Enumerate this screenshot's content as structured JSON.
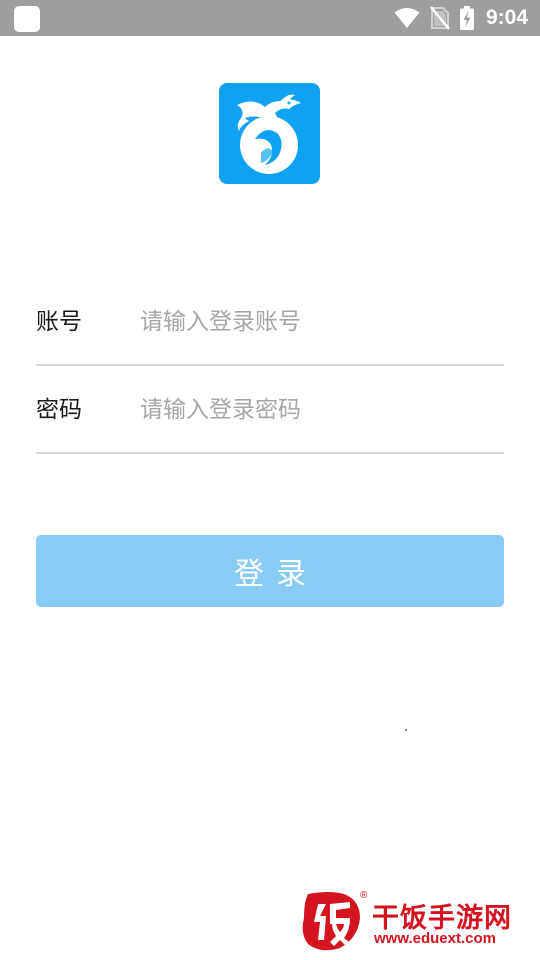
{
  "status_bar": {
    "time": "9:04",
    "icons": [
      "app-notification-icon",
      "wifi-icon",
      "no-sim-icon",
      "battery-charging-icon"
    ]
  },
  "app": {
    "logo_icon": "dragon-pearl-logo-icon",
    "accent_color": "#10a2f2"
  },
  "form": {
    "account": {
      "label": "账号",
      "placeholder": "请输入登录账号",
      "value": ""
    },
    "password": {
      "label": "密码",
      "placeholder": "请输入登录密码",
      "value": ""
    },
    "login_button_label": "登录",
    "login_button_color": "#88cbf5"
  },
  "watermark": {
    "name": "干饭手游网",
    "url": "www.eduext.com",
    "registered_mark": "®",
    "color": "#d4141e"
  }
}
